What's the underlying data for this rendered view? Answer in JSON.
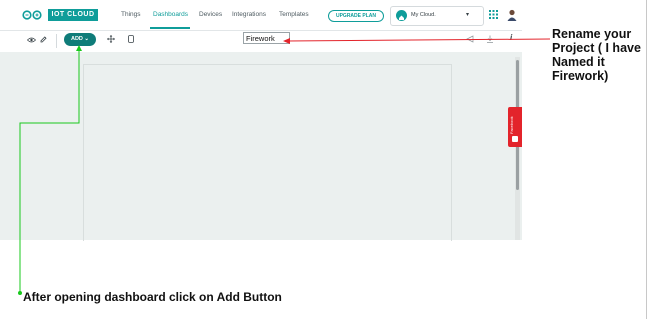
{
  "app": {
    "logo_text": "IOT CLOUD"
  },
  "nav": {
    "items": [
      {
        "label": "Things"
      },
      {
        "label": "Dashboards",
        "active": true
      },
      {
        "label": "Devices"
      },
      {
        "label": "Integrations"
      },
      {
        "label": "Templates"
      }
    ],
    "upgrade_label": "UPGRADE PLAN",
    "cloud_selector": "My Cloud."
  },
  "toolbar": {
    "add_label": "ADD ⌄",
    "dashboard_name": "Firework"
  },
  "facebook_tab": "Facebook",
  "annotations": {
    "rename_note": "Rename your Project ( I have Named it Firework)",
    "add_note": "After opening dashboard click on Add Button"
  },
  "colors": {
    "accent": "#0f9d9a",
    "annotation_red": "#e3242b",
    "annotation_green": "#18c91c",
    "facebook_red": "#e3242b"
  }
}
